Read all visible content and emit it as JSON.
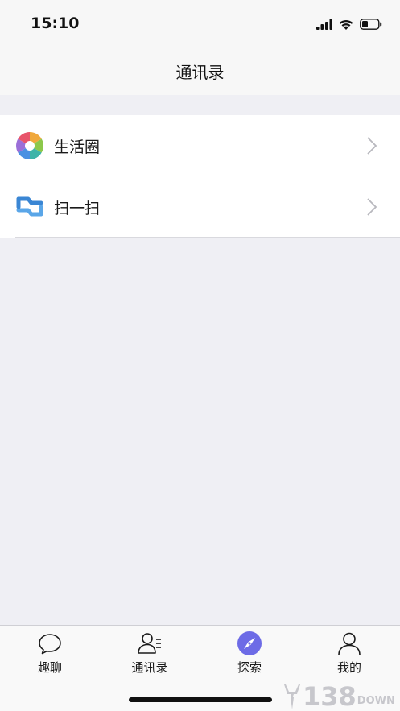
{
  "status_bar": {
    "time": "15:10",
    "icons": [
      "signal-icon",
      "wifi-icon",
      "battery-icon"
    ]
  },
  "nav": {
    "title": "通讯录"
  },
  "list": {
    "items": [
      {
        "label": "生活圈",
        "icon": "aperture-icon"
      },
      {
        "label": "扫一扫",
        "icon": "scan-icon"
      }
    ]
  },
  "tabbar": {
    "active_color": "#6d6be6",
    "tabs": [
      {
        "label": "趣聊",
        "icon": "chat-bubble-icon"
      },
      {
        "label": "通讯录",
        "icon": "contacts-icon"
      },
      {
        "label": "探索",
        "icon": "compass-icon",
        "active": true
      },
      {
        "label": "我的",
        "icon": "profile-icon"
      }
    ]
  },
  "watermark": {
    "number": "138",
    "text": "DOWN"
  }
}
